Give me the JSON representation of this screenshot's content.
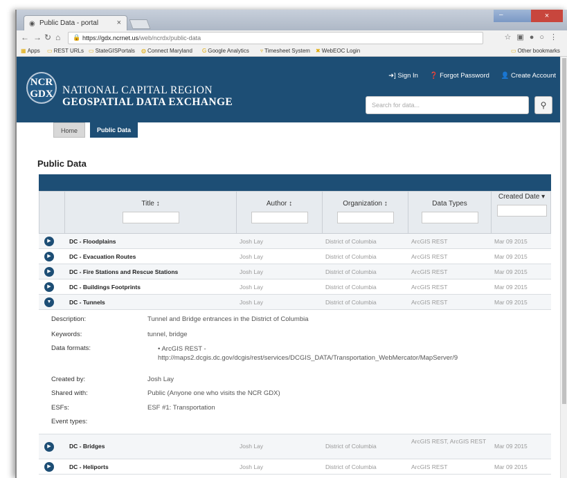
{
  "browser": {
    "tab_title": "Public Data - portal",
    "url_host": "https://gdx.ncrnet.us",
    "url_path": "/web/ncrdx/public-data",
    "bookmarks": [
      "Apps",
      "REST URLs",
      "StateGISPortals",
      "Connect Maryland",
      "Google Analytics",
      "Timesheet System",
      "WebEOC Login",
      "Other bookmarks"
    ]
  },
  "site": {
    "logo_line1": "NCR",
    "logo_line2": "GDX",
    "title_line1": "NATIONAL CAPITAL REGION",
    "title_line2": "GEOSPATIAL DATA EXCHANGE",
    "sign_in": "Sign In",
    "forgot_password": "Forgot Password",
    "create_account": "Create Account",
    "search_placeholder": "Search for data..."
  },
  "nav": {
    "home": "Home",
    "public_data": "Public Data"
  },
  "page": {
    "heading": "Public Data"
  },
  "table": {
    "columns": [
      "Title",
      "Author",
      "Organization",
      "Data Types",
      "Created Date"
    ],
    "rows": [
      {
        "title": "DC - Floodplains",
        "author": "Josh Lay",
        "org": "District of Columbia",
        "type": "ArcGIS REST",
        "date": "Mar 09 2015"
      },
      {
        "title": "DC - Evacuation Routes",
        "author": "Josh Lay",
        "org": "District of Columbia",
        "type": "ArcGIS REST",
        "date": "Mar 09 2015"
      },
      {
        "title": "DC - Fire Stations and Rescue Stations",
        "author": "Josh Lay",
        "org": "District of Columbia",
        "type": "ArcGIS REST",
        "date": "Mar 09 2015"
      },
      {
        "title": "DC - Buildings Footprints",
        "author": "Josh Lay",
        "org": "District of Columbia",
        "type": "ArcGIS REST",
        "date": "Mar 09 2015"
      },
      {
        "title": "DC - Tunnels",
        "author": "Josh Lay",
        "org": "District of Columbia",
        "type": "ArcGIS REST",
        "date": "Mar 09 2015"
      }
    ],
    "rows_after": [
      {
        "title": "DC - Bridges",
        "author": "Josh Lay",
        "org": "District of Columbia",
        "type": "ArcGIS REST, ArcGIS REST",
        "date": "Mar 09 2015"
      },
      {
        "title": "DC - Heliports",
        "author": "Josh Lay",
        "org": "District of Columbia",
        "type": "ArcGIS REST",
        "date": "Mar 09 2015"
      }
    ]
  },
  "details": {
    "description_label": "Description:",
    "description": "Tunnel and Bridge entrances in the District of Columbia",
    "keywords_label": "Keywords:",
    "keywords": "tunnel, bridge",
    "formats_label": "Data formats:",
    "format_name": "ArcGIS REST -",
    "format_url": "http://maps2.dcgis.dc.gov/dcgis/rest/services/DCGIS_DATA/Transportation_WebMercator/MapServer/9",
    "created_by_label": "Created by:",
    "created_by": "Josh Lay",
    "shared_with_label": "Shared with:",
    "shared_with": "Public (Anyone one who visits the NCR GDX)",
    "esfs_label": "ESFs:",
    "esfs": "ESF #1: Transportation",
    "event_types_label": "Event types:"
  }
}
